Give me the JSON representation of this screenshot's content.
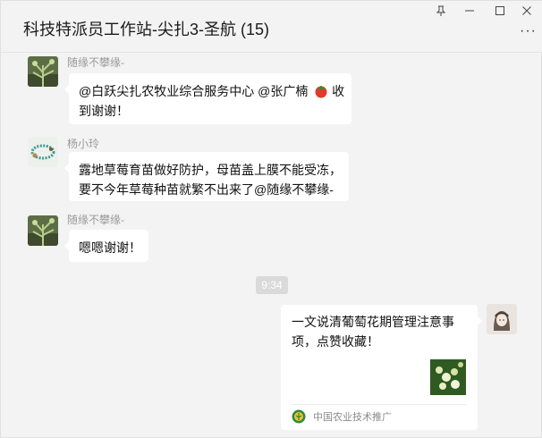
{
  "window": {
    "title": "科技特派员工作站-尖扎3-圣航 (15)",
    "controls": {
      "pin": "⊼",
      "minimize": "—",
      "maximize": "☐",
      "close": "✕",
      "more": "···"
    }
  },
  "messages": [
    {
      "sender": "随缘不攀缘-",
      "text_line1": "@白跃尖扎农牧业综合服务中心 @张广楠",
      "emoji": "tomato-emoji",
      "text_suffix": " 收",
      "text_line2": "到谢谢！"
    },
    {
      "sender": "杨小玲",
      "text_line1": "露地草莓育苗做好防护，母苗盖上膜不能受冻，",
      "text_line2": "要不今年草莓种苗就繁不出来了@随缘不攀缘-"
    },
    {
      "sender": "随缘不攀缘-",
      "text": "嗯嗯谢谢！"
    }
  ],
  "time_divider": "9:34",
  "shared_card": {
    "title": "一文说清葡萄花期管理注意事项，点赞收藏！",
    "source": "中国农业技术推广",
    "thumb": "grape-flower-image"
  },
  "colors": {
    "background": "#f3f3f3",
    "bubble": "#ffffff",
    "sender": "#9a9a9a",
    "source_logo": "#2e8b3d"
  }
}
